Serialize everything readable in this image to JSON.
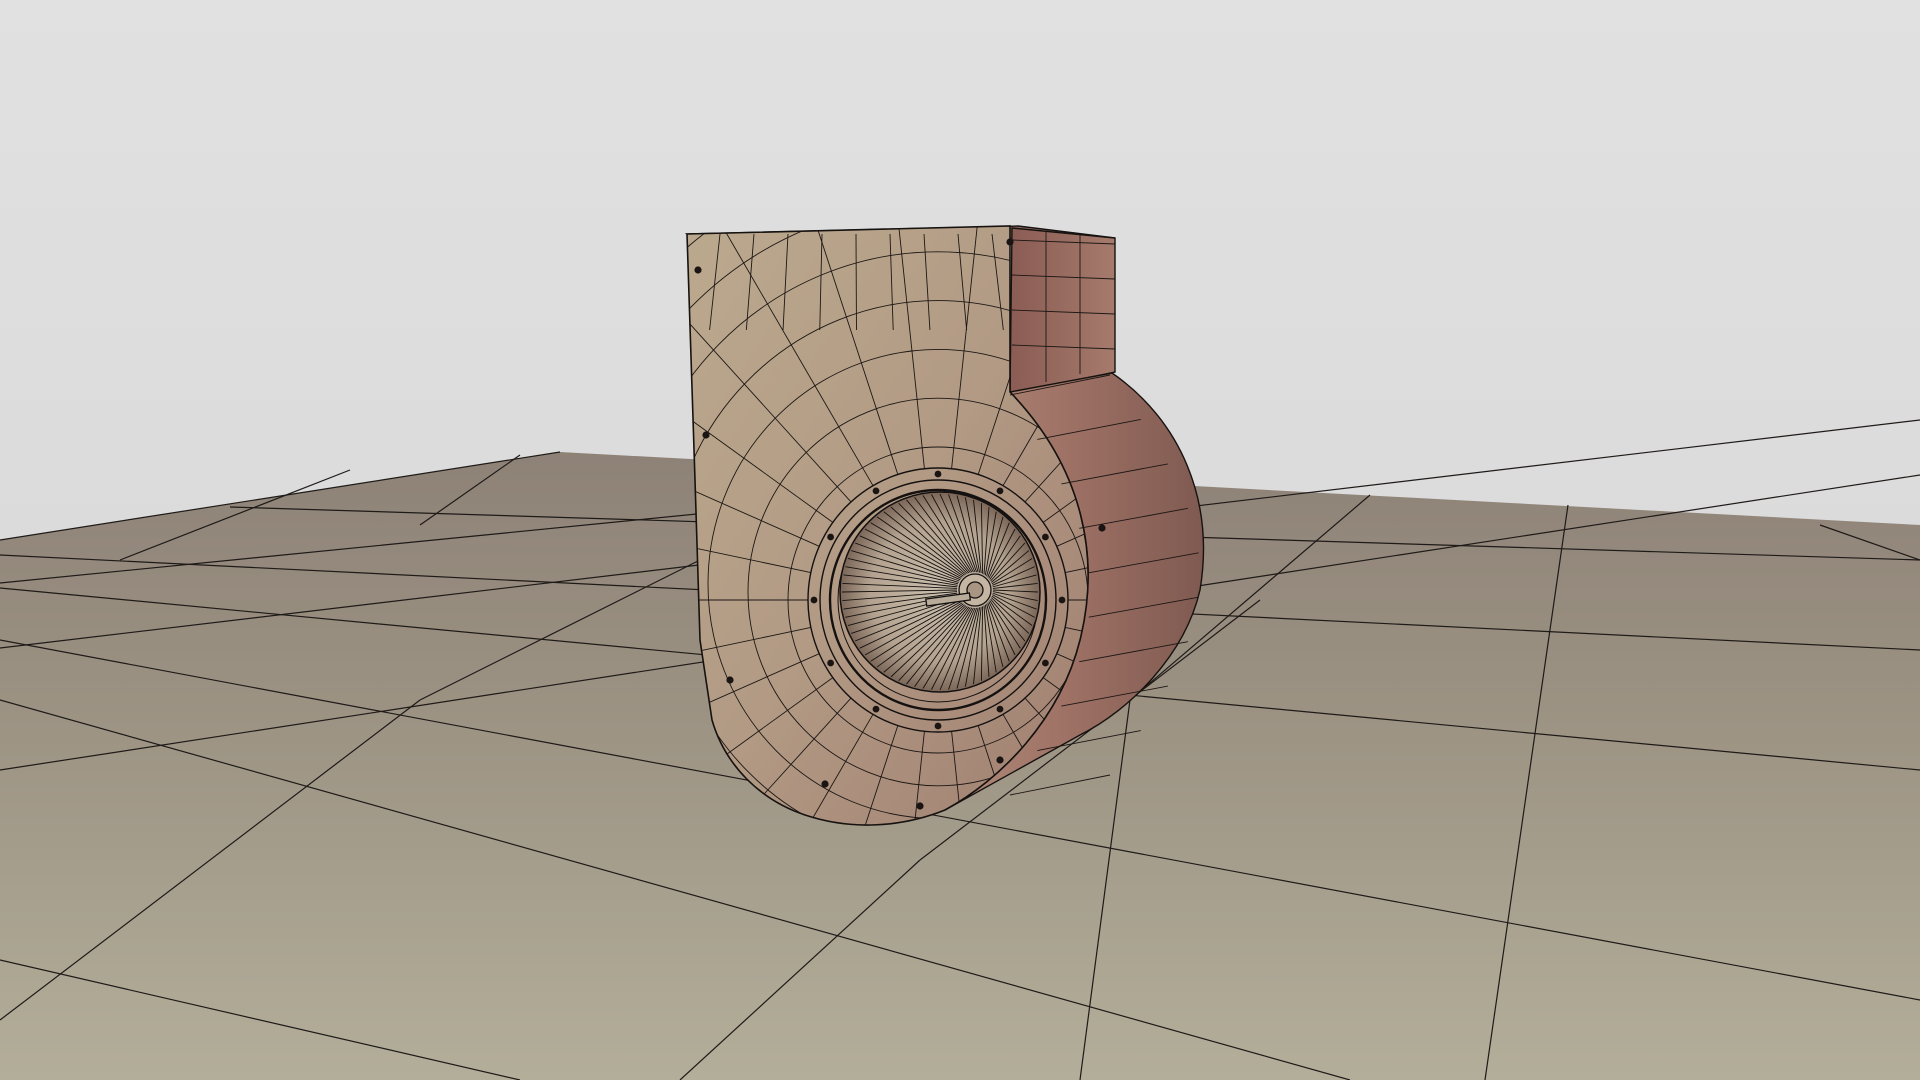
{
  "viewport": {
    "background_top": "#e0e0e0",
    "background_bottom": "#d6d6d6",
    "floor_far": "#8f8378",
    "floor_near": "#b2ad99",
    "grid_line": "#1a1a1a",
    "wire": "#161210",
    "model_light": "#b8a88e",
    "model_mid": "#a58a78",
    "model_dark": "#7d5a52",
    "side_face": "#a2766a"
  },
  "scene": {
    "object": "centrifugal-blower-wireframe-model"
  }
}
